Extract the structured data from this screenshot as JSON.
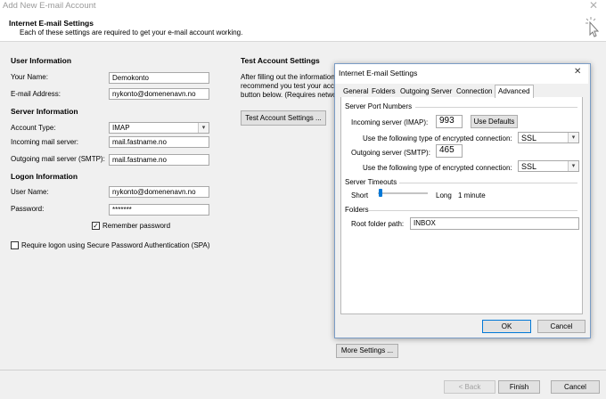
{
  "window": {
    "title": "Add New E-mail Account"
  },
  "header": {
    "title": "Internet E-mail Settings",
    "subtitle": "Each of these settings are required to get your e-mail account working."
  },
  "user_info": {
    "section": "User Information",
    "name_label": "Your Name:",
    "name_value": "Demokonto",
    "email_label": "E-mail Address:",
    "email_value": "nykonto@domenenavn.no"
  },
  "server_info": {
    "section": "Server Information",
    "account_type_label": "Account Type:",
    "account_type_value": "IMAP",
    "incoming_label": "Incoming mail server:",
    "incoming_value": "mail.fastname.no",
    "outgoing_label": "Outgoing mail server (SMTP):",
    "outgoing_value": "mail.fastname.no"
  },
  "logon_info": {
    "section": "Logon Information",
    "user_label": "User Name:",
    "user_value": "nykonto@domenenavn.no",
    "password_label": "Password:",
    "password_value": "*******",
    "remember_label": "Remember password",
    "remember_checked": "✓",
    "spa_label": "Require logon using Secure Password Authentication (SPA)"
  },
  "test_settings": {
    "section": "Test Account Settings",
    "line1": "After filling out the information",
    "line2": "recommend you test your acco",
    "line3": "button below. (Requires netwo",
    "button": "Test Account Settings ..."
  },
  "more_settings_button": "More Settings ...",
  "footer": {
    "back": "< Back",
    "finish": "Finish",
    "cancel": "Cancel"
  },
  "dialog": {
    "title": "Internet E-mail Settings",
    "tabs": [
      "General",
      "Folders",
      "Outgoing Server",
      "Connection",
      "Advanced"
    ],
    "ports_group": "Server Port Numbers",
    "incoming_label": "Incoming server (IMAP):",
    "incoming_port": "993",
    "use_defaults": "Use Defaults",
    "enc_label": "Use the following type of encrypted connection:",
    "incoming_enc": "SSL",
    "outgoing_label": "Outgoing server (SMTP):",
    "outgoing_port": "465",
    "outgoing_enc": "SSL",
    "timeouts_group": "Server Timeouts",
    "short_label": "Short",
    "long_label": "Long",
    "timeout_value": "1 minute",
    "folders_group": "Folders",
    "root_label": "Root folder path:",
    "root_value": "INBOX",
    "ok": "OK",
    "cancel": "Cancel"
  }
}
